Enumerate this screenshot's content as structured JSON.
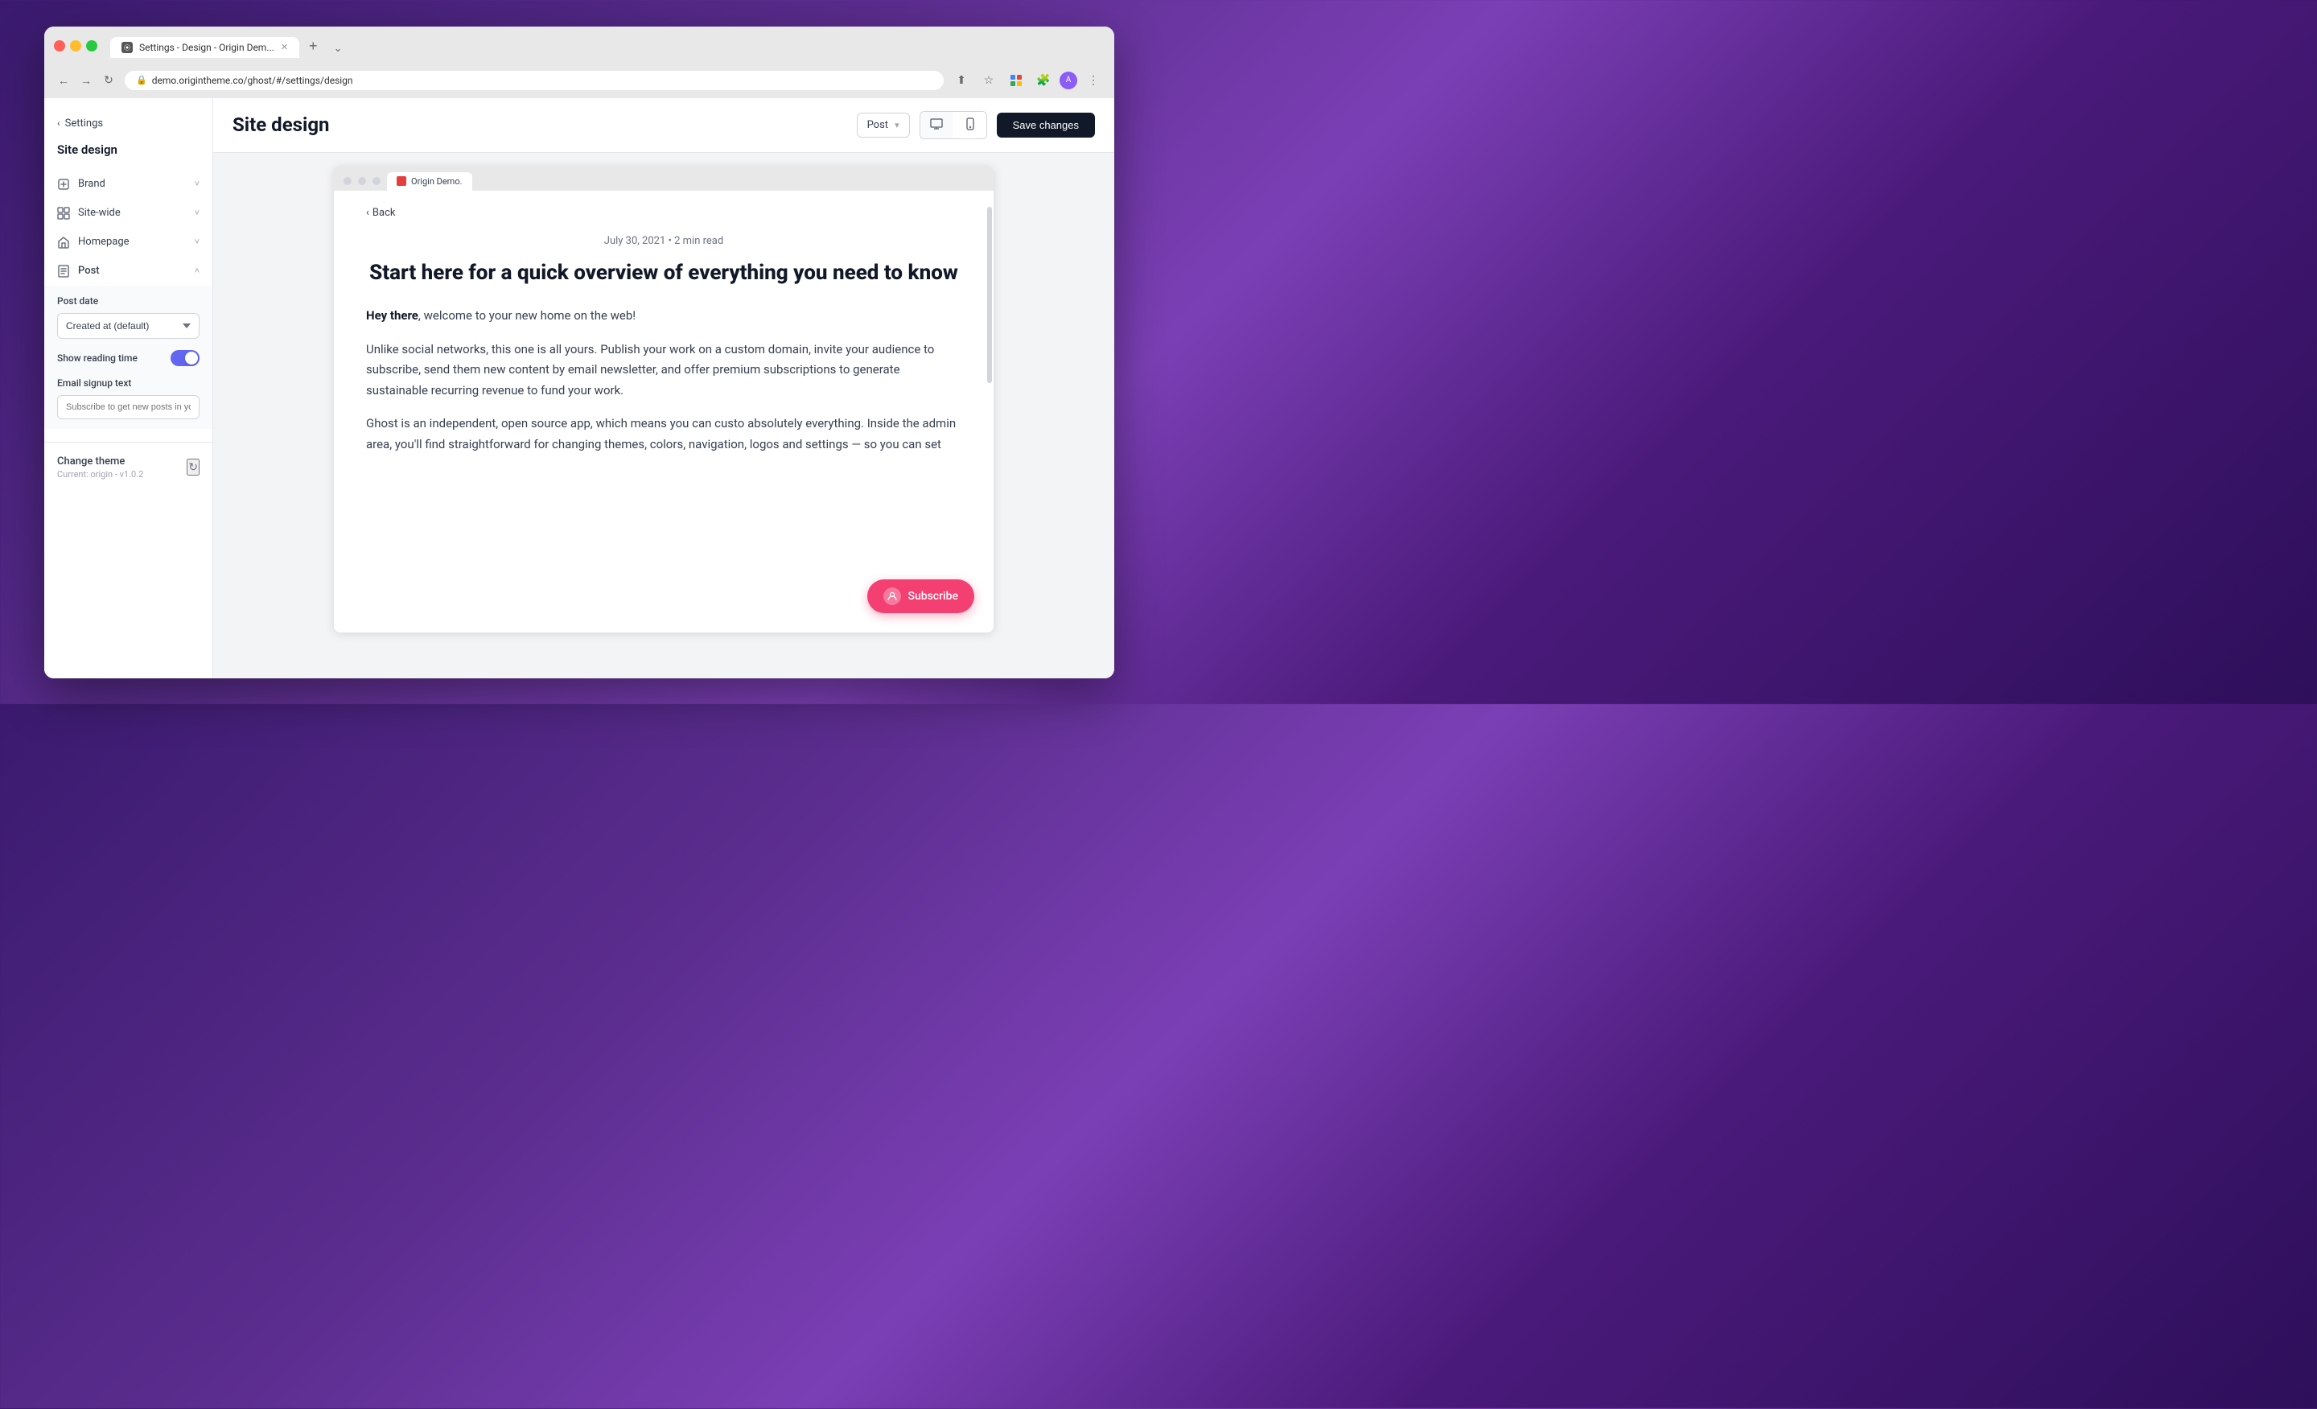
{
  "browser": {
    "tab_title": "Settings - Design - Origin Dem...",
    "address": "demo.origintheme.co/ghost/#/settings/design",
    "new_tab_label": "+",
    "dropdown_label": "⌄"
  },
  "header": {
    "title": "Site design",
    "save_label": "Save changes",
    "post_selector": "Post",
    "post_selector_chevron": "▾"
  },
  "sidebar": {
    "back_label": "Settings",
    "title": "Site design",
    "items": [
      {
        "id": "brand",
        "label": "Brand"
      },
      {
        "id": "site-wide",
        "label": "Site-wide"
      },
      {
        "id": "homepage",
        "label": "Homepage"
      },
      {
        "id": "post",
        "label": "Post"
      }
    ],
    "post_date": {
      "label": "Post date",
      "value": "Created at (default)"
    },
    "show_reading_time": {
      "label": "Show reading time",
      "enabled": true
    },
    "email_signup": {
      "label": "Email signup text",
      "placeholder": "Subscribe to get new posts in your in"
    },
    "change_theme": {
      "title": "Change theme",
      "subtitle": "Current: origin - v1.0.2"
    }
  },
  "preview": {
    "tab_label": "Origin Demo.",
    "back_label": "Back",
    "post_meta": "July 30, 2021  •  2 min read",
    "post_title": "Start here for a quick overview of everything you need to know",
    "paragraphs": [
      {
        "text_before_bold": "",
        "bold": "Hey there",
        "text_after": ", welcome to your new home on the web!"
      },
      {
        "text": "Unlike social networks, this one is all yours. Publish your work on a custom domain, invite your audience to subscribe, send them new content by email newsletter, and offer premium subscriptions to generate sustainable recurring revenue to fund your work."
      },
      {
        "text": "Ghost is an independent, open source app, which means you can custo absolutely everything. Inside the admin area, you'll find straightforward for changing themes, colors, navigation, logos and settings — so you can set"
      }
    ],
    "subscribe_label": "Subscribe"
  }
}
